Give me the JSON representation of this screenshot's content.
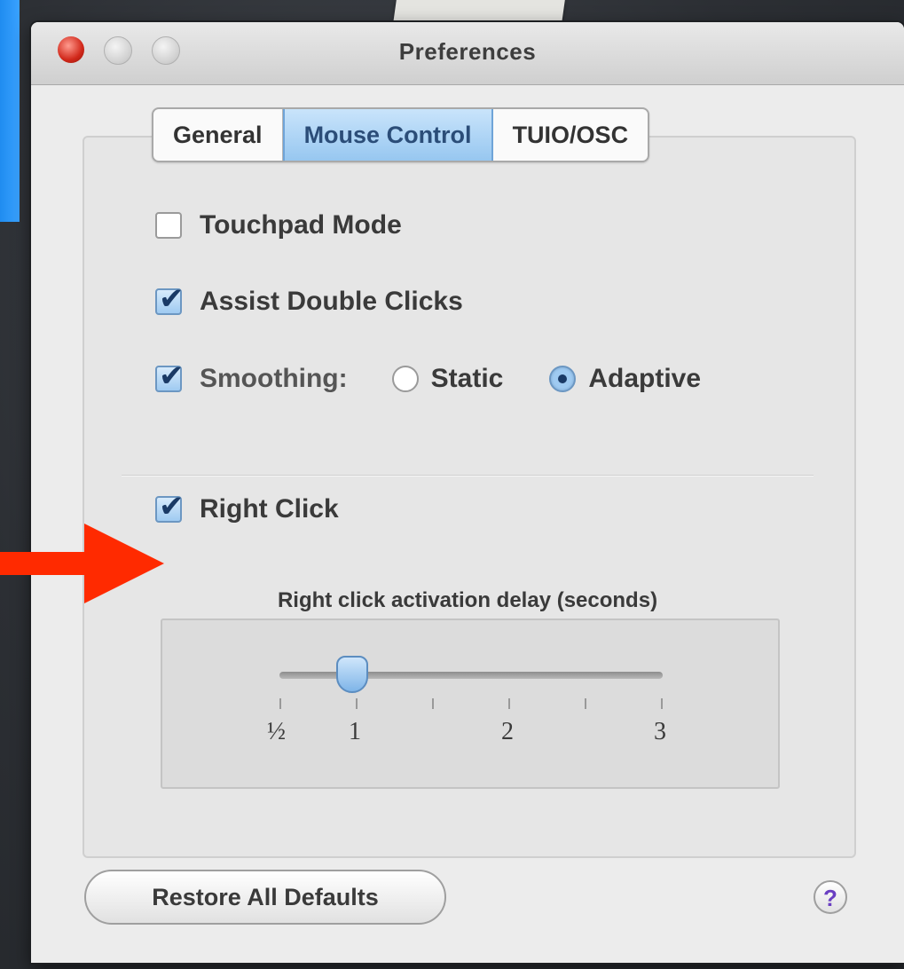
{
  "window": {
    "title": "Preferences"
  },
  "tabs": [
    {
      "label": "General",
      "active": false
    },
    {
      "label": "Mouse Control",
      "active": true
    },
    {
      "label": "TUIO/OSC",
      "active": false
    }
  ],
  "options": {
    "touchpad_mode": {
      "label": "Touchpad Mode",
      "checked": false
    },
    "assist_double_clicks": {
      "label": "Assist Double Clicks",
      "checked": true
    },
    "smoothing": {
      "label": "Smoothing:",
      "checked": true,
      "radio_static": "Static",
      "radio_adaptive": "Adaptive",
      "selected": "Adaptive"
    },
    "right_click": {
      "label": "Right Click",
      "checked": true
    }
  },
  "slider": {
    "label": "Right click activation delay (seconds)",
    "tick_labels": [
      "½",
      "1",
      "2",
      "3"
    ],
    "value": 1,
    "min": 0.5,
    "max": 3
  },
  "buttons": {
    "restore": "Restore All Defaults",
    "help": "?"
  },
  "colors": {
    "arrow": "#ff2a00",
    "accent": "#97c7f0"
  }
}
